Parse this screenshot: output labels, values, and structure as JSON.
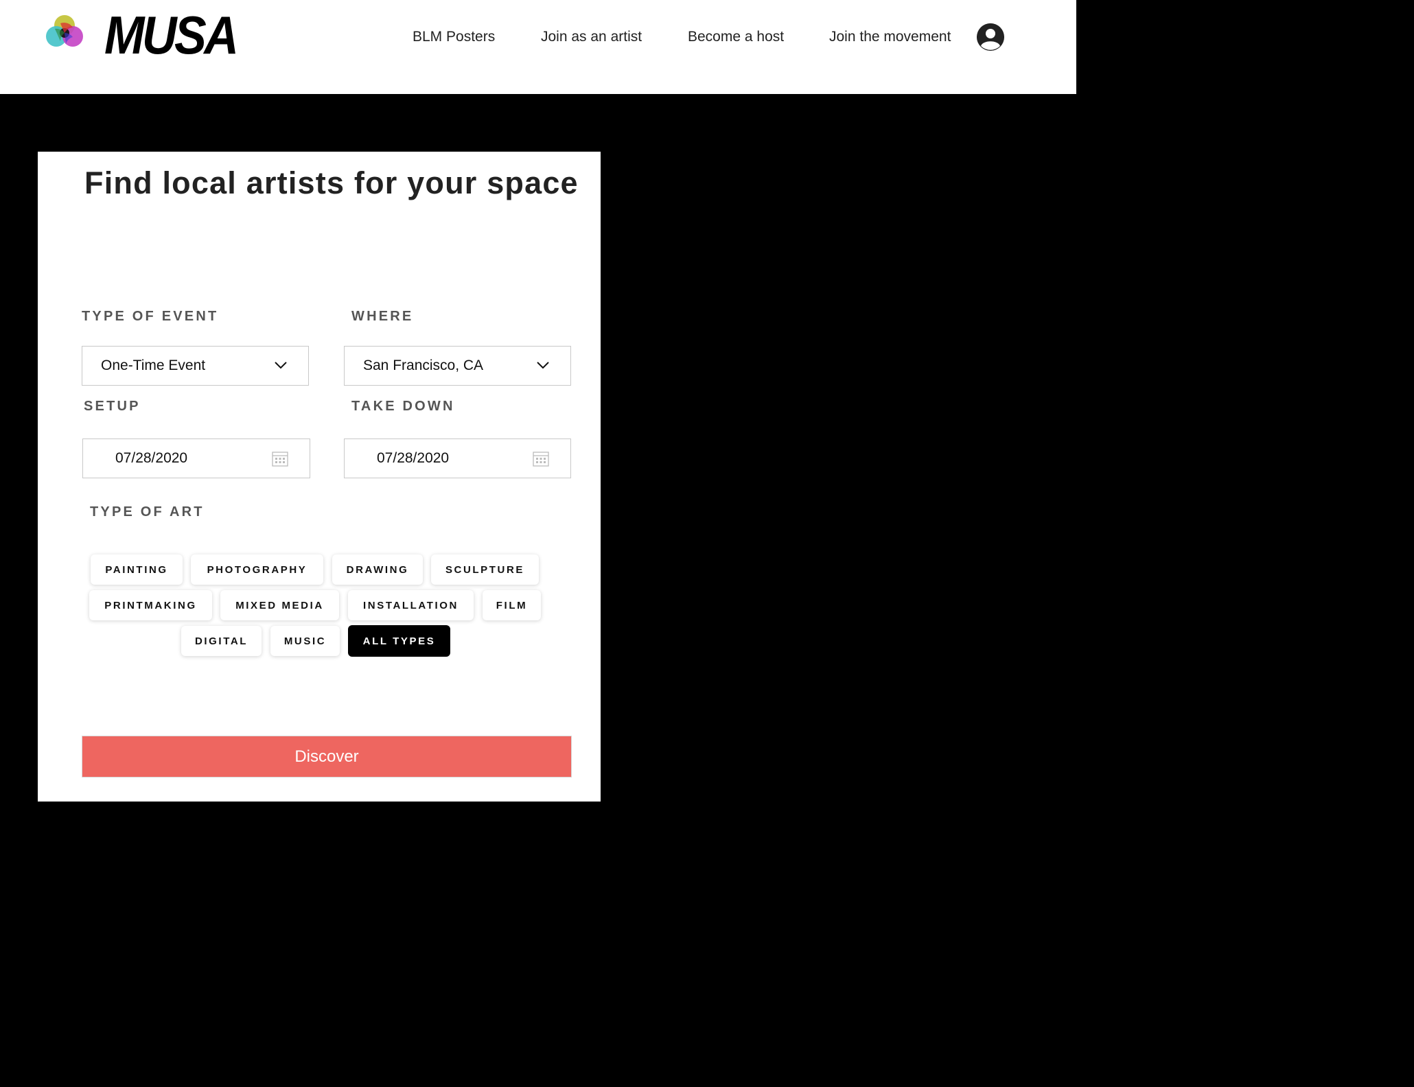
{
  "header": {
    "logo_text": "MUSA",
    "nav": [
      {
        "label": "BLM Posters"
      },
      {
        "label": "Join as an artist"
      },
      {
        "label": "Become a host"
      },
      {
        "label": "Join the movement"
      }
    ]
  },
  "form": {
    "title": "Find local artists for your space",
    "event_type": {
      "label": "TYPE OF EVENT",
      "value": "One-Time Event"
    },
    "where": {
      "label": "WHERE",
      "value": "San Francisco, CA"
    },
    "setup": {
      "label": "SETUP",
      "value": "07/28/2020"
    },
    "take_down": {
      "label": "TAKE DOWN",
      "value": "07/28/2020"
    },
    "art_type": {
      "label": "TYPE OF ART",
      "options": [
        {
          "label": "PAINTING",
          "selected": false
        },
        {
          "label": "PHOTOGRAPHY",
          "selected": false
        },
        {
          "label": "DRAWING",
          "selected": false
        },
        {
          "label": "SCULPTURE",
          "selected": false
        },
        {
          "label": "PRINTMAKING",
          "selected": false
        },
        {
          "label": "MIXED MEDIA",
          "selected": false
        },
        {
          "label": "INSTALLATION",
          "selected": false
        },
        {
          "label": "FILM",
          "selected": false
        },
        {
          "label": "DIGITAL",
          "selected": false
        },
        {
          "label": "MUSIC",
          "selected": false
        },
        {
          "label": "ALL TYPES",
          "selected": true
        }
      ]
    },
    "submit_label": "Discover"
  },
  "colors": {
    "accent": "#ee6660",
    "page_background": "#000000",
    "card_background": "#ffffff",
    "chip_selected": "#000000"
  },
  "icons": {
    "logo_mark": "overlapping-circles-icon",
    "profile": "user-avatar-icon",
    "dropdown": "chevron-down-icon",
    "date": "calendar-icon"
  }
}
